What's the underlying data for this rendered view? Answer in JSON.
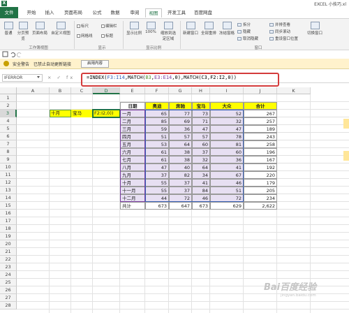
{
  "window": {
    "title": "EXCEL 小技巧.xl"
  },
  "ribbon": {
    "file_tab": "文件",
    "tabs": [
      "开始",
      "插入",
      "页面布局",
      "公式",
      "数据",
      "审阅",
      "视图",
      "开发工具",
      "百度网盘"
    ],
    "active_tab": "视图",
    "buttons": {
      "normal": "普通",
      "page_break": "分页预览",
      "page_layout": "页面布局",
      "custom_views": "自定义视图",
      "zoom": "显示比例",
      "zoom_100": "100%",
      "zoom_selection": "缩放到选定区域",
      "new_window": "新建窗口",
      "arrange_all": "全部重排",
      "freeze_panes": "冻结窗格",
      "split": "拆分",
      "hide": "隐藏",
      "unhide": "取消隐藏",
      "side_by_side": "并排查看",
      "sync_scroll": "同步滚动",
      "reset_position": "重设窗口位置",
      "switch_windows": "切换窗口"
    },
    "checkboxes": {
      "ruler": "标尺",
      "formula_bar": "编辑栏",
      "gridlines": "网格线",
      "headings": "标题"
    },
    "groups": {
      "workbook_views": "工作簿视图",
      "show": "显示",
      "zoom": "显示比例",
      "window": "窗口"
    }
  },
  "security_bar": {
    "title": "安全警告",
    "message": "已禁止自动更新链接",
    "button": "启用内容"
  },
  "formula_bar": {
    "name_box": "IFERROR",
    "fx_buttons": "× ✓ fx",
    "formula_parts": [
      {
        "text": "=INDEX(",
        "color": "black"
      },
      {
        "text": "F3:I14",
        "color": "blue"
      },
      {
        "text": ",MATCH(",
        "color": "black"
      },
      {
        "text": "B3",
        "color": "green"
      },
      {
        "text": ",",
        "color": "black"
      },
      {
        "text": "E3:E14",
        "color": "purple"
      },
      {
        "text": ",0),MATCH(C3,F2:I2,0))",
        "color": "black"
      }
    ]
  },
  "sheet": {
    "columns": [
      "A",
      "B",
      "C",
      "D",
      "E",
      "F",
      "G",
      "H",
      "I",
      "J",
      "K"
    ],
    "rows": [
      "1",
      "2",
      "3",
      "4",
      "5",
      "6",
      "7",
      "8",
      "9",
      "10",
      "11",
      "12",
      "13",
      "14",
      "15",
      "16",
      "17",
      "18",
      "19",
      "20",
      "21",
      "22",
      "23",
      "24",
      "25",
      "26",
      "27",
      "28"
    ],
    "lookup": {
      "month": "十月",
      "brand": "宝马",
      "formula_tail": "F2:I2,0))"
    },
    "table": {
      "headers": [
        "日期",
        "奥迪",
        "奔驰",
        "宝马",
        "大众",
        "合计"
      ],
      "rows": [
        [
          "一月",
          "65",
          "77",
          "73",
          "52",
          "267"
        ],
        [
          "二月",
          "85",
          "69",
          "71",
          "32",
          "257"
        ],
        [
          "三月",
          "59",
          "36",
          "47",
          "47",
          "189"
        ],
        [
          "四月",
          "51",
          "57",
          "57",
          "78",
          "243"
        ],
        [
          "五月",
          "53",
          "64",
          "60",
          "81",
          "258"
        ],
        [
          "六月",
          "61",
          "38",
          "37",
          "60",
          "196"
        ],
        [
          "七月",
          "61",
          "38",
          "32",
          "36",
          "167"
        ],
        [
          "八月",
          "47",
          "40",
          "64",
          "41",
          "192"
        ],
        [
          "九月",
          "37",
          "82",
          "34",
          "67",
          "220"
        ],
        [
          "十月",
          "55",
          "37",
          "41",
          "46",
          "179"
        ],
        [
          "十一月",
          "55",
          "37",
          "84",
          "51",
          "205"
        ],
        [
          "十二月",
          "44",
          "72",
          "46",
          "72",
          "234"
        ]
      ],
      "total": [
        "共计",
        "673",
        "647",
        "673",
        "629",
        "2,622"
      ]
    }
  },
  "watermark": {
    "main": "Bai百度经验",
    "sub": "jingyan.baidu.com"
  }
}
